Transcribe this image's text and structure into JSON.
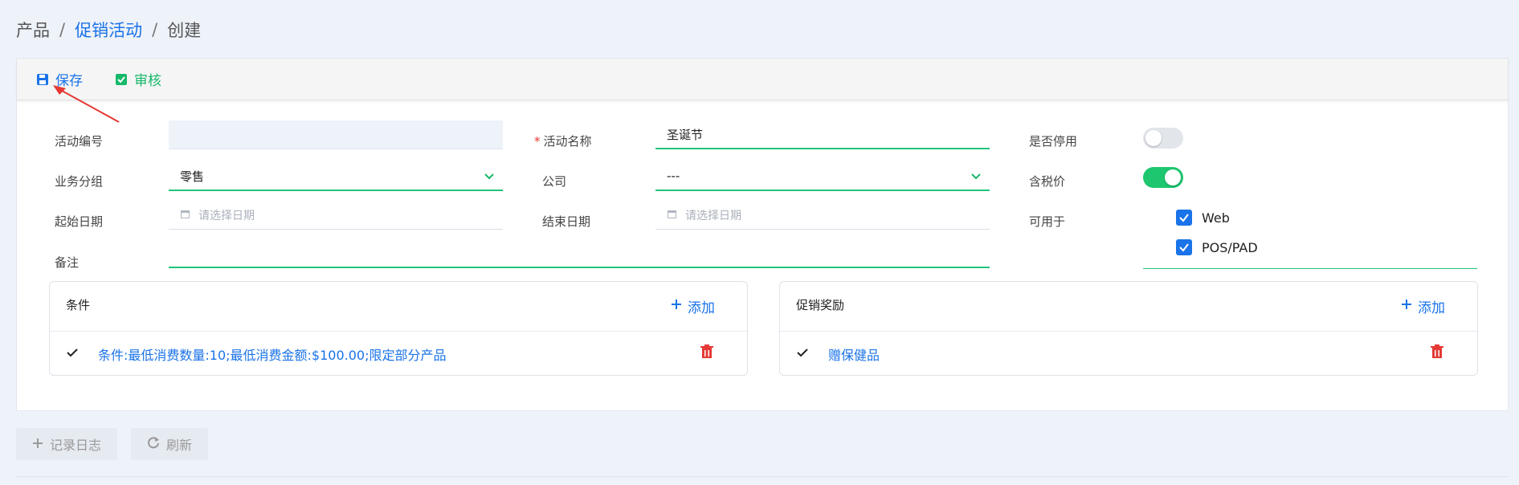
{
  "breadcrumb": {
    "items": [
      "产品",
      "促销活动",
      "创建"
    ],
    "separator": "/"
  },
  "toolbar": {
    "save_label": "保存",
    "audit_label": "审核"
  },
  "form": {
    "code_label": "活动编号",
    "code_value": "",
    "name_label": "活动名称",
    "name_required": "*",
    "name_value": "圣诞节",
    "disabled_label": "是否停用",
    "disabled_on": false,
    "group_label": "业务分组",
    "group_value": "零售",
    "company_label": "公司",
    "company_value": "---",
    "tax_label": "含税价",
    "tax_on": true,
    "start_label": "起始日期",
    "start_placeholder": "请选择日期",
    "end_label": "结束日期",
    "end_placeholder": "请选择日期",
    "usable_label": "可用于",
    "usable_options": [
      {
        "label": "Web",
        "checked": true
      },
      {
        "label": "POS/PAD",
        "checked": true
      }
    ],
    "remark_label": "备注",
    "remark_value": ""
  },
  "conditions": {
    "title": "条件",
    "add_label": "添加",
    "rows": [
      "条件:最低消费数量:10;最低消费金额:$100.00;限定部分产品"
    ]
  },
  "rewards": {
    "title": "促销奖励",
    "add_label": "添加",
    "rows": [
      "赠保健品"
    ]
  },
  "footer": {
    "log_label": "记录日志",
    "refresh_label": "刷新"
  },
  "colors": {
    "primary": "#1a73e8",
    "success": "#16b86a",
    "toggle_on": "#1ec76f",
    "danger": "#e53935"
  }
}
